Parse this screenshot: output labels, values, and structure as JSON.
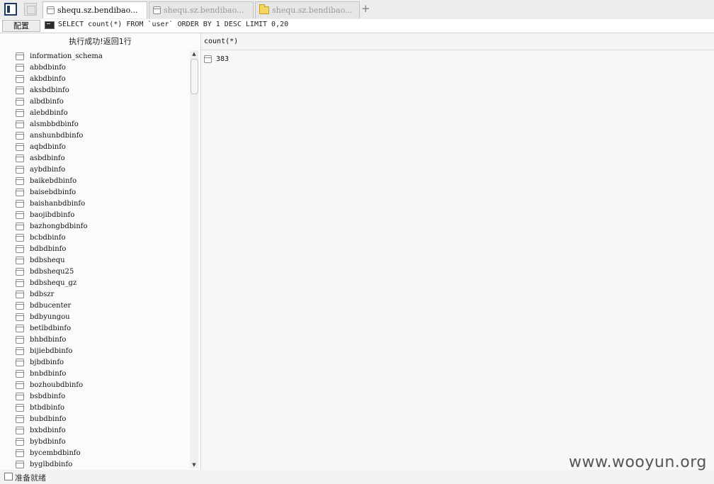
{
  "tabs": [
    {
      "label": "shequ.sz.bendibao...",
      "icon": "database-icon",
      "active": true
    },
    {
      "label": "shequ.sz.bendibao...",
      "icon": "database-icon",
      "active": false
    },
    {
      "label": "shequ.sz.bendibao...",
      "icon": "folder-icon",
      "active": false
    }
  ],
  "tab_add_label": "+",
  "toolbar": {
    "config_label": "配置"
  },
  "query": {
    "sql": "SELECT count(*) FROM `user` ORDER BY 1 DESC LIMIT 0,20"
  },
  "left_panel": {
    "status": "执行成功!返回1行",
    "databases": [
      "information_schema",
      "abbdbinfo",
      "akbdbinfo",
      "aksbdbinfo",
      "albdbinfo",
      "alebdbinfo",
      "alsmbbdbinfo",
      "anshunbdbinfo",
      "aqbdbinfo",
      "asbdbinfo",
      "aybdbinfo",
      "baikebdbinfo",
      "baisebdbinfo",
      "baishanbdbinfo",
      "baojibdbinfo",
      "bazhongbdbinfo",
      "bcbdbinfo",
      "bdbdbinfo",
      "bdbshequ",
      "bdbshequ25",
      "bdbshequ_gz",
      "bdbszr",
      "bdbucenter",
      "bdbyungou",
      "betlbdbinfo",
      "bhbdbinfo",
      "bijiebdbinfo",
      "bjbdbinfo",
      "bnbdbinfo",
      "bozhoubdbinfo",
      "bsbdbinfo",
      "btbdbinfo",
      "bubdbinfo",
      "bxbdbinfo",
      "bybdbinfo",
      "bycembdbinfo",
      "byglbdbinfo"
    ]
  },
  "results": {
    "column": "count(*)",
    "rows": [
      "383"
    ]
  },
  "scrollbar": {
    "up": "▲",
    "down": "▼"
  },
  "status_bar": {
    "text": "准备就绪"
  },
  "watermark": "www.wooyun.org"
}
